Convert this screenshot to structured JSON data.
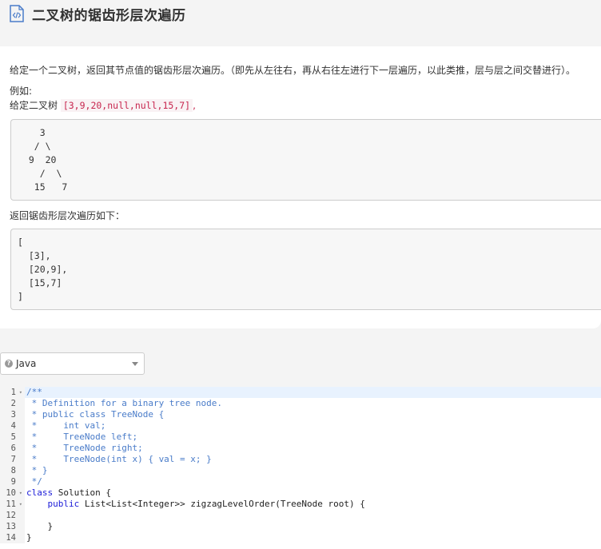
{
  "header": {
    "title": "二叉树的锯齿形层次遍历",
    "icon": "code-file-icon"
  },
  "problem": {
    "description": "给定一个二叉树，返回其节点值的锯齿形层次遍历。（即先从左往右，再从右往左进行下一层遍历，以此类推，层与层之间交替进行）。",
    "example_label": "例如:",
    "given_prefix": "给定二叉树 ",
    "given_value": "[3,9,20,null,null,15,7]",
    "given_suffix": ",",
    "tree_text": "    3\n   / \\\n  9  20\n    /  \\\n   15   7",
    "return_label": "返回锯齿形层次遍历如下：",
    "result_text": "[\n  [3],\n  [20,9],\n  [15,7]\n]"
  },
  "language_select": {
    "value": "Java",
    "help_icon": "question-circle-icon"
  },
  "editor": {
    "lines": [
      {
        "num": "1",
        "fold": "▾",
        "text": "/**",
        "cls": "cm"
      },
      {
        "num": "2",
        "fold": "",
        "text": " * Definition for a binary tree node.",
        "cls": "cm"
      },
      {
        "num": "3",
        "fold": "",
        "text": " * public class TreeNode {",
        "cls": "cm"
      },
      {
        "num": "4",
        "fold": "",
        "text": " *     int val;",
        "cls": "cm"
      },
      {
        "num": "5",
        "fold": "",
        "text": " *     TreeNode left;",
        "cls": "cm"
      },
      {
        "num": "6",
        "fold": "",
        "text": " *     TreeNode right;",
        "cls": "cm"
      },
      {
        "num": "7",
        "fold": "",
        "text": " *     TreeNode(int x) { val = x; }",
        "cls": "cm"
      },
      {
        "num": "8",
        "fold": "",
        "text": " * }",
        "cls": "cm"
      },
      {
        "num": "9",
        "fold": "",
        "text": " */",
        "cls": "cm"
      },
      {
        "num": "10",
        "fold": "▾",
        "text": "class Solution {",
        "cls": "mix1"
      },
      {
        "num": "11",
        "fold": "▾",
        "text": "    public List<List<Integer>> zigzagLevelOrder(TreeNode root) {",
        "cls": "mix2"
      },
      {
        "num": "12",
        "fold": "",
        "text": "",
        "cls": "tx"
      },
      {
        "num": "13",
        "fold": "",
        "text": "    }",
        "cls": "tx"
      },
      {
        "num": "14",
        "fold": "",
        "text": "}",
        "cls": "tx"
      }
    ]
  }
}
